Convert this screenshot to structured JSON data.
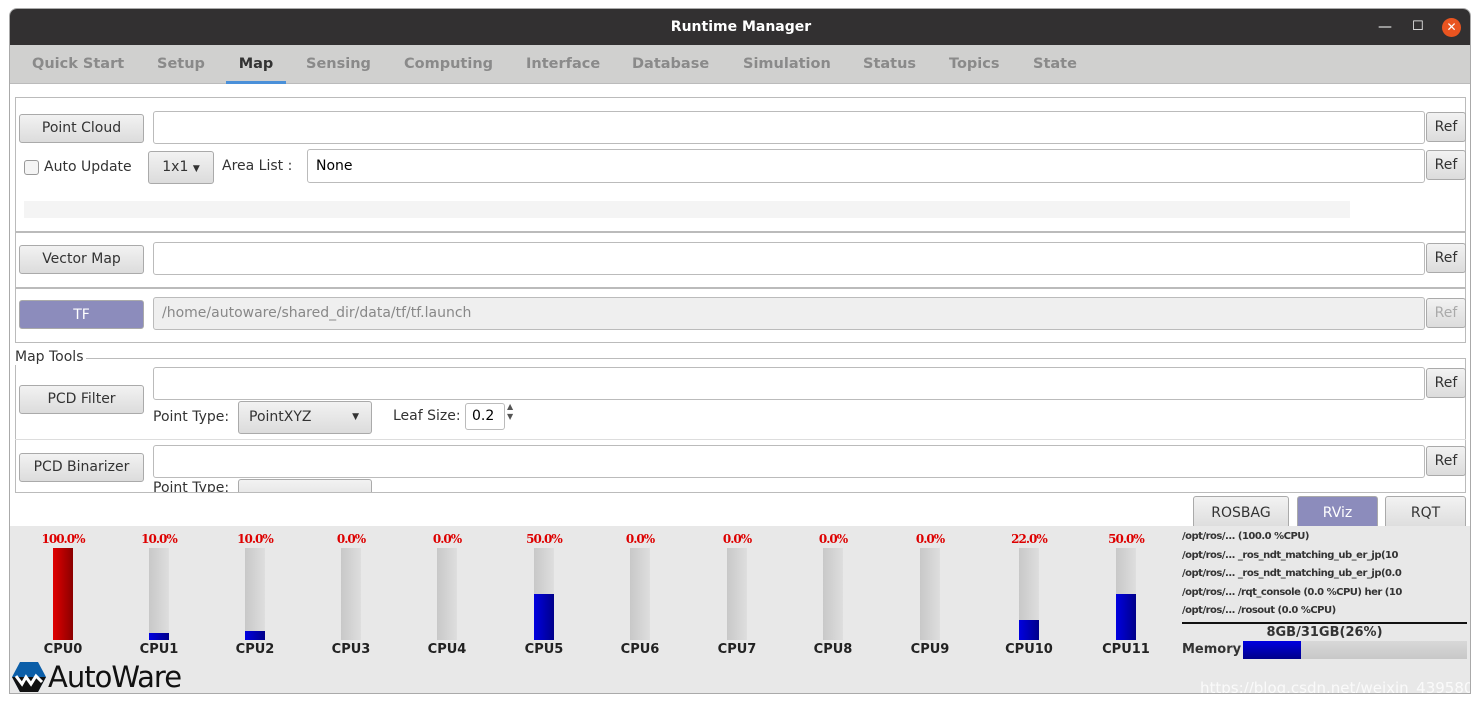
{
  "window": {
    "title": "Runtime Manager",
    "minimize": "—",
    "maximize": "☐",
    "close": "✕"
  },
  "tabs": [
    {
      "label": "Quick Start"
    },
    {
      "label": "Setup"
    },
    {
      "label": "Map",
      "active": true
    },
    {
      "label": "Sensing"
    },
    {
      "label": "Computing"
    },
    {
      "label": "Interface"
    },
    {
      "label": "Database"
    },
    {
      "label": "Simulation"
    },
    {
      "label": "Status"
    },
    {
      "label": "Topics"
    },
    {
      "label": "State"
    }
  ],
  "map": {
    "point_cloud": {
      "button": "Point Cloud",
      "path": "",
      "ref": "Ref",
      "auto_update": "Auto Update",
      "auto_update_checked": false,
      "grid": "1x1",
      "area_list_label": "Area List :",
      "area_list": "None",
      "area_ref": "Ref"
    },
    "vector_map": {
      "button": "Vector Map",
      "path": "",
      "ref": "Ref"
    },
    "tf": {
      "button": "TF",
      "path": "/home/autoware/shared_dir/data/tf/tf.launch",
      "ref": "Ref",
      "active_color": "#8c8cbc"
    },
    "map_tools": {
      "label": "Map Tools",
      "pcd_filter": {
        "button": "PCD Filter",
        "path": "",
        "ref": "Ref",
        "point_type_label": "Point Type:",
        "point_type": "PointXYZ",
        "leaf_size_label": "Leaf Size:",
        "leaf_size": "0.2"
      },
      "pcd_binarizer": {
        "button": "PCD Binarizer",
        "path": "",
        "ref": "Ref",
        "point_type_label": "Point Type:"
      }
    }
  },
  "actions": {
    "rosbag": "ROSBAG",
    "rviz": "RViz",
    "rqt": "RQT"
  },
  "cpus": [
    {
      "name": "CPU0",
      "pct": "100.0%",
      "value": 100
    },
    {
      "name": "CPU1",
      "pct": "10.0%",
      "value": 8
    },
    {
      "name": "CPU2",
      "pct": "10.0%",
      "value": 10
    },
    {
      "name": "CPU3",
      "pct": "0.0%",
      "value": 0
    },
    {
      "name": "CPU4",
      "pct": "0.0%",
      "value": 0
    },
    {
      "name": "CPU5",
      "pct": "50.0%",
      "value": 50
    },
    {
      "name": "CPU6",
      "pct": "0.0%",
      "value": 0
    },
    {
      "name": "CPU7",
      "pct": "0.0%",
      "value": 0
    },
    {
      "name": "CPU8",
      "pct": "0.0%",
      "value": 0
    },
    {
      "name": "CPU9",
      "pct": "0.0%",
      "value": 0
    },
    {
      "name": "CPU10",
      "pct": "22.0%",
      "value": 22
    },
    {
      "name": "CPU11",
      "pct": "50.0%",
      "value": 50
    }
  ],
  "processes": [
    "/opt/ros/... (100.0 %CPU)",
    "/opt/ros/... _ros_ndt_matching_ub_er_jp(10",
    "/opt/ros/... _ros_ndt_matching_ub_er_jp(0.0",
    "/opt/ros/... /rqt_console (0.0 %CPU) her (10",
    "/opt/ros/... /rosout (0.0 %CPU)"
  ],
  "memory": {
    "label": "Memory",
    "text": "8GB/31GB(26%)",
    "value": 26
  },
  "logo": "AutoWare",
  "watermark": "https://blog.csdn.net/weixin_43958086",
  "colors": {
    "cpu_high": "#e00000",
    "cpu_normal": "#0000d0",
    "tab_accent": "#4a90d9",
    "close": "#e95420"
  }
}
